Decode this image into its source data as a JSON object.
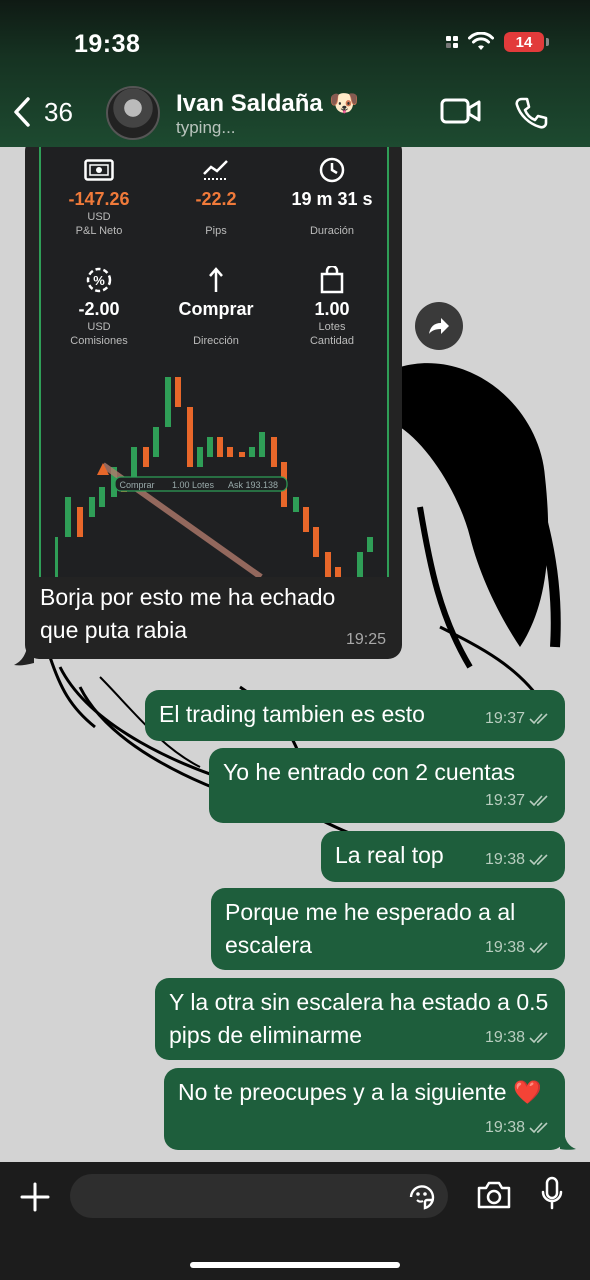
{
  "status_bar": {
    "time": "19:38",
    "battery": "14"
  },
  "header": {
    "back_count": "36",
    "contact_name": "Ivan Saldaña 🐶",
    "contact_status": "typing..."
  },
  "trade_card": {
    "stats": [
      {
        "icon": "cash-icon",
        "value": "-147.26",
        "sub1": "USD",
        "sub2": "P&L Neto",
        "negative": true
      },
      {
        "icon": "pips-chart-icon",
        "value": "-22.2",
        "sub1": "Pips",
        "sub2": "",
        "negative": true
      },
      {
        "icon": "clock-icon",
        "value": "19 m 31 s",
        "sub1": "Duración",
        "sub2": "",
        "negative": false
      },
      {
        "icon": "percent-icon",
        "value": "-2.00",
        "sub1": "USD",
        "sub2": "Comisiones",
        "negative": false
      },
      {
        "icon": "arrow-up-icon",
        "value": "Comprar",
        "sub1": "Dirección",
        "sub2": "",
        "negative": false
      },
      {
        "icon": "bag-icon",
        "value": "1.00",
        "sub1": "Lotes",
        "sub2": "Cantidad",
        "negative": false
      }
    ],
    "chart_labels": {
      "side": "Comprar",
      "lots": "1.00 Lotes",
      "ask": "Ask 193.138"
    }
  },
  "messages": [
    {
      "direction": "in",
      "text": "Borja por esto me ha echado que puta rabia",
      "time": "19:25"
    },
    {
      "direction": "out",
      "text": "El trading tambien es esto",
      "time": "19:37"
    },
    {
      "direction": "out",
      "text": "Yo he entrado con 2 cuentas",
      "time": "19:37"
    },
    {
      "direction": "out",
      "text": "La real top",
      "time": "19:38"
    },
    {
      "direction": "out",
      "text": "Porque me he esperado a al escalera",
      "time": "19:38"
    },
    {
      "direction": "out",
      "text": "Y la otra sin escalera ha estado a 0.5 pips de eliminarme",
      "time": "19:38"
    },
    {
      "direction": "out",
      "text": "No te preocupes y a la siguiente ❤️",
      "time": "19:38"
    }
  ]
}
